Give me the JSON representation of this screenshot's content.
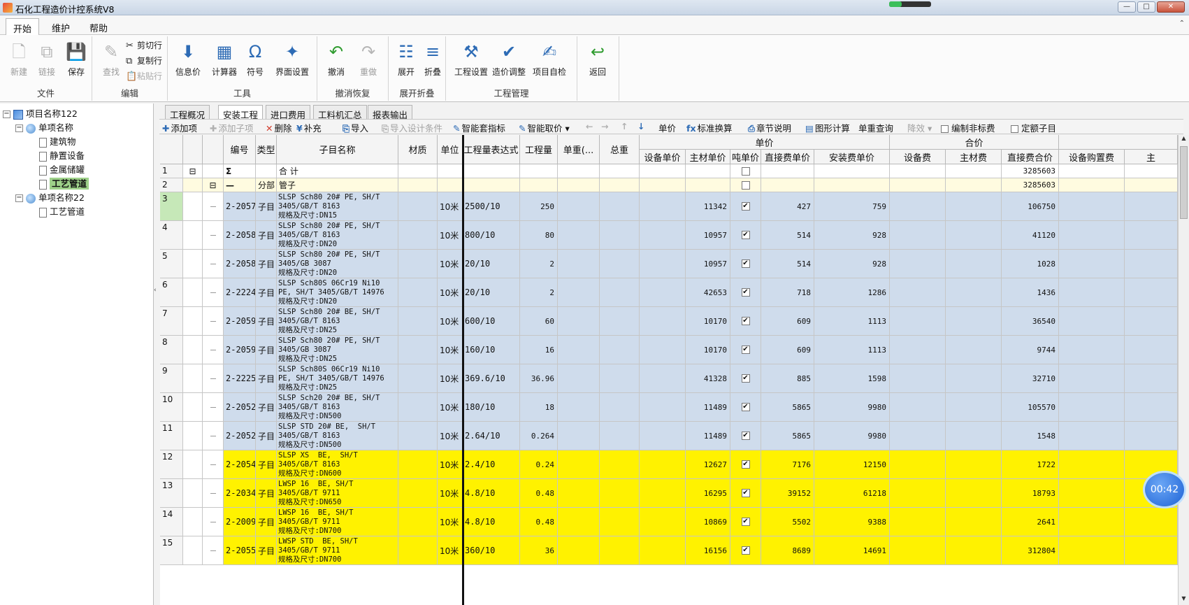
{
  "window": {
    "title": "石化工程造价计控系统V8",
    "min": "—",
    "max": "□",
    "close": "✕"
  },
  "menu": {
    "tabs": [
      "开始",
      "维护",
      "帮助"
    ],
    "help_arrow": "⌃"
  },
  "ribbon": {
    "groups": [
      {
        "name": "文件",
        "buttons": [
          {
            "label": "新建",
            "icon": "new-icon",
            "glyph": "🗋",
            "disabled": true
          },
          {
            "label": "链接",
            "icon": "link-icon",
            "glyph": "⧉",
            "disabled": true
          },
          {
            "label": "保存",
            "icon": "save-icon",
            "glyph": "💾",
            "disabled": false
          }
        ]
      },
      {
        "name": "编辑",
        "buttons": [
          {
            "label": "查找",
            "icon": "find-icon",
            "glyph": "✎",
            "disabled": true
          }
        ],
        "small": [
          {
            "label": "剪切行",
            "icon": "cut-icon",
            "glyph": "✂",
            "disabled": false
          },
          {
            "label": "复制行",
            "icon": "copy-icon",
            "glyph": "⧉",
            "disabled": false
          },
          {
            "label": "粘贴行",
            "icon": "paste-icon",
            "glyph": "📋",
            "disabled": true
          }
        ]
      },
      {
        "name": "工具",
        "buttons": [
          {
            "label": "信息价",
            "icon": "info-price-icon",
            "glyph": "⬇",
            "disabled": false
          },
          {
            "label": "计算器",
            "icon": "calculator-icon",
            "glyph": "▦",
            "disabled": false
          },
          {
            "label": "符号",
            "icon": "omega-icon",
            "glyph": "Ω",
            "disabled": false
          },
          {
            "label": "界面设置",
            "icon": "ui-settings-icon",
            "glyph": "✦",
            "disabled": false
          }
        ]
      },
      {
        "name": "撤消恢复",
        "buttons": [
          {
            "label": "撤消",
            "icon": "undo-icon",
            "glyph": "↶",
            "disabled": false
          },
          {
            "label": "重做",
            "icon": "redo-icon",
            "glyph": "↷",
            "disabled": true
          }
        ]
      },
      {
        "name": "展开折叠",
        "buttons": [
          {
            "label": "展开",
            "icon": "expand-icon",
            "glyph": "☷",
            "disabled": false
          },
          {
            "label": "折叠",
            "icon": "collapse-icon",
            "glyph": "≡",
            "disabled": false
          }
        ]
      },
      {
        "name": "工程管理",
        "buttons": [
          {
            "label": "工程设置",
            "icon": "project-settings-icon",
            "glyph": "⚒",
            "disabled": false
          },
          {
            "label": "造价调整",
            "icon": "cost-adjust-icon",
            "glyph": "✔",
            "disabled": false
          },
          {
            "label": "项目自检",
            "icon": "self-check-icon",
            "glyph": "✍",
            "disabled": false
          }
        ]
      },
      {
        "name": "",
        "buttons": [
          {
            "label": "返回",
            "icon": "return-icon",
            "glyph": "↩",
            "disabled": false
          }
        ]
      }
    ]
  },
  "tree": {
    "root": "项目名称122",
    "items": [
      {
        "label": "单项名称",
        "level": 1,
        "type": "unit",
        "expander": "−"
      },
      {
        "label": "建筑物",
        "level": 2,
        "type": "doc"
      },
      {
        "label": "静置设备",
        "level": 2,
        "type": "doc"
      },
      {
        "label": "金属储罐",
        "level": 2,
        "type": "doc"
      },
      {
        "label": "工艺管道",
        "level": 2,
        "type": "doc",
        "selected": true
      },
      {
        "label": "单项名称22",
        "level": 1,
        "type": "unit",
        "expander": "−"
      },
      {
        "label": "工艺管道",
        "level": 2,
        "type": "doc"
      }
    ],
    "collapse_arrow": "‹"
  },
  "content_tabs": [
    "工程概况",
    "安装工程",
    "进口费用",
    "工料机汇总",
    "报表输出"
  ],
  "toolbar": {
    "items": [
      {
        "label": "添加项",
        "glyph": "✚",
        "disabled": false
      },
      {
        "label": "添加子项",
        "glyph": "✚",
        "disabled": true
      },
      {
        "label": "删除",
        "glyph": "✕",
        "disabled": false
      },
      {
        "label": "补充",
        "glyph": "¥",
        "disabled": false
      },
      {
        "label": "导入",
        "glyph": "⎘",
        "disabled": false
      },
      {
        "label": "导入设计条件",
        "glyph": "⎘",
        "disabled": true
      },
      {
        "label": "智能套指标",
        "glyph": "✎",
        "disabled": false
      },
      {
        "label": "智能取价 ▾",
        "glyph": "✎",
        "disabled": false
      },
      {
        "label": "",
        "glyph": "←",
        "disabled": true
      },
      {
        "label": "",
        "glyph": "→",
        "disabled": true
      },
      {
        "label": "",
        "glyph": "↑",
        "disabled": true
      },
      {
        "label": "",
        "glyph": "↓",
        "disabled": false
      },
      {
        "label": "单价",
        "glyph": "",
        "disabled": false
      },
      {
        "label": "标准换算",
        "glyph": "fx",
        "disabled": false
      },
      {
        "label": "章节说明",
        "glyph": "⎙",
        "disabled": false
      },
      {
        "label": "图形计算",
        "glyph": "▤",
        "disabled": false
      },
      {
        "label": "单重查询",
        "glyph": "",
        "disabled": false
      },
      {
        "label": "降效 ▾",
        "glyph": "",
        "disabled": true
      },
      {
        "label": "编制非标费",
        "glyph": "☐",
        "disabled": false
      },
      {
        "label": "定额子目",
        "glyph": "☐",
        "disabled": false
      }
    ]
  },
  "grid": {
    "headers": {
      "code": "编号",
      "type": "类型",
      "name": "子目名称",
      "material": "材质",
      "unit": "单位",
      "expr": "工程量表达式",
      "qty": "工程量",
      "unit_weight": "单重(...",
      "total_weight": "总重",
      "group_unit_price": "单价",
      "equip_unit": "设备单价",
      "main_mat_unit": "主材单价",
      "ton_price": "吨单价",
      "direct_unit": "直接费单价",
      "install_unit": "安装费单价",
      "group_total": "合价",
      "equip_fee": "设备费",
      "main_mat_fee": "主材费",
      "direct_total": "直接费合价",
      "equip_purchase": "设备购置费",
      "extra": "主"
    },
    "summary_rows": [
      {
        "num": "1",
        "tree": "⊟",
        "sigma": "Σ",
        "code": "",
        "type": "",
        "name": "合 计",
        "direct_total": "3285603",
        "style": "white"
      },
      {
        "num": "2",
        "tree": "⊟",
        "sigma": "—",
        "code": "",
        "type": "分部",
        "name": "管子",
        "direct_total": "3285603",
        "style": "lightyellow"
      }
    ],
    "rows": [
      {
        "num": "3",
        "code": "2-2057",
        "type": "子目",
        "name": [
          "SLSP Sch80 20# PE, SH/T",
          "3405/GB/T 8163",
          "规格及尺寸:DN15"
        ],
        "unit": "10米",
        "expr": "2500/10",
        "qty": "250",
        "main_mat_unit": "11342",
        "checked": true,
        "direct_unit": "427",
        "install_unit": "759",
        "direct_total": "106750",
        "style": "blue",
        "current": true
      },
      {
        "num": "4",
        "code": "2-2058",
        "type": "子目",
        "name": [
          "SLSP Sch80 20# PE, SH/T",
          "3405/GB/T 8163",
          "规格及尺寸:DN20"
        ],
        "unit": "10米",
        "expr": "800/10",
        "qty": "80",
        "main_mat_unit": "10957",
        "checked": true,
        "direct_unit": "514",
        "install_unit": "928",
        "direct_total": "41120",
        "style": "blue"
      },
      {
        "num": "5",
        "code": "2-2058",
        "type": "子目",
        "name": [
          "SLSP Sch80 20# PE, SH/T",
          "3405/GB 3087",
          "规格及尺寸:DN20"
        ],
        "unit": "10米",
        "expr": "20/10",
        "qty": "2",
        "main_mat_unit": "10957",
        "checked": true,
        "direct_unit": "514",
        "install_unit": "928",
        "direct_total": "1028",
        "style": "blue"
      },
      {
        "num": "6",
        "code": "2-2224",
        "type": "子目",
        "name": [
          "SLSP Sch80S 06Cr19 Ni10",
          "PE, SH/T 3405/GB/T 14976",
          "规格及尺寸:DN20"
        ],
        "unit": "10米",
        "expr": "20/10",
        "qty": "2",
        "main_mat_unit": "42653",
        "checked": true,
        "direct_unit": "718",
        "install_unit": "1286",
        "direct_total": "1436",
        "style": "blue"
      },
      {
        "num": "7",
        "code": "2-2059",
        "type": "子目",
        "name": [
          "SLSP Sch80 20# BE, SH/T",
          "3405/GB/T 8163",
          "规格及尺寸:DN25"
        ],
        "unit": "10米",
        "expr": "600/10",
        "qty": "60",
        "main_mat_unit": "10170",
        "checked": true,
        "direct_unit": "609",
        "install_unit": "1113",
        "direct_total": "36540",
        "style": "blue"
      },
      {
        "num": "8",
        "code": "2-2059",
        "type": "子目",
        "name": [
          "SLSP Sch80 20# PE, SH/T",
          "3405/GB 3087",
          "规格及尺寸:DN25"
        ],
        "unit": "10米",
        "expr": "160/10",
        "qty": "16",
        "main_mat_unit": "10170",
        "checked": true,
        "direct_unit": "609",
        "install_unit": "1113",
        "direct_total": "9744",
        "style": "blue"
      },
      {
        "num": "9",
        "code": "2-2225",
        "type": "子目",
        "name": [
          "SLSP Sch80S 06Cr19 Ni10",
          "PE, SH/T 3405/GB/T 14976",
          "规格及尺寸:DN25"
        ],
        "unit": "10米",
        "expr": "369.6/10",
        "qty": "36.96",
        "main_mat_unit": "41328",
        "checked": true,
        "direct_unit": "885",
        "install_unit": "1598",
        "direct_total": "32710",
        "style": "blue"
      },
      {
        "num": "10",
        "code": "2-2052",
        "type": "子目",
        "name": [
          "SLSP Sch20 20# BE, SH/T",
          "3405/GB/T 8163",
          "规格及尺寸:DN500"
        ],
        "unit": "10米",
        "expr": "180/10",
        "qty": "18",
        "main_mat_unit": "11489",
        "checked": true,
        "direct_unit": "5865",
        "install_unit": "9980",
        "direct_total": "105570",
        "style": "blue"
      },
      {
        "num": "11",
        "code": "2-2052",
        "type": "子目",
        "name": [
          "SLSP STD 20# BE,  SH/T",
          "3405/GB/T 8163",
          "规格及尺寸:DN500"
        ],
        "unit": "10米",
        "expr": "2.64/10",
        "qty": "0.264",
        "main_mat_unit": "11489",
        "checked": true,
        "direct_unit": "5865",
        "install_unit": "9980",
        "direct_total": "1548",
        "style": "blue"
      },
      {
        "num": "12",
        "code": "2-2054",
        "type": "子目",
        "name": [
          "SLSP XS  BE,  SH/T",
          "3405/GB/T 8163",
          "规格及尺寸:DN600"
        ],
        "unit": "10米",
        "expr": "2.4/10",
        "qty": "0.24",
        "main_mat_unit": "12627",
        "checked": true,
        "direct_unit": "7176",
        "install_unit": "12150",
        "direct_total": "1722",
        "style": "yellow"
      },
      {
        "num": "13",
        "code": "2-2034",
        "type": "子目",
        "name": [
          "LWSP 16  BE, SH/T",
          "3405/GB/T 9711",
          "规格及尺寸:DN650"
        ],
        "unit": "10米",
        "expr": "4.8/10",
        "qty": "0.48",
        "main_mat_unit": "16295",
        "checked": true,
        "direct_unit": "39152",
        "install_unit": "61218",
        "direct_total": "18793",
        "style": "yellow"
      },
      {
        "num": "14",
        "code": "2-2009",
        "type": "子目",
        "name": [
          "LWSP 16  BE, SH/T",
          "3405/GB/T 9711",
          "规格及尺寸:DN700"
        ],
        "unit": "10米",
        "expr": "4.8/10",
        "qty": "0.48",
        "main_mat_unit": "10869",
        "checked": true,
        "direct_unit": "5502",
        "install_unit": "9388",
        "direct_total": "2641",
        "style": "yellow"
      },
      {
        "num": "15",
        "code": "2-2055",
        "type": "子目",
        "name": [
          "LWSP STD  BE, SH/T",
          "3405/GB/T 9711",
          "规格及尺寸:DN700"
        ],
        "unit": "10米",
        "expr": "360/10",
        "qty": "36",
        "main_mat_unit": "16156",
        "checked": true,
        "direct_unit": "8689",
        "install_unit": "14691",
        "direct_total": "312804",
        "style": "yellow"
      }
    ]
  },
  "timer": "00:42",
  "colors": {
    "blue_row": "#cfdcec",
    "yellow_row": "#fff200",
    "lightyellow_row": "#fffbe0",
    "selected_tree": "#9ed18a"
  }
}
